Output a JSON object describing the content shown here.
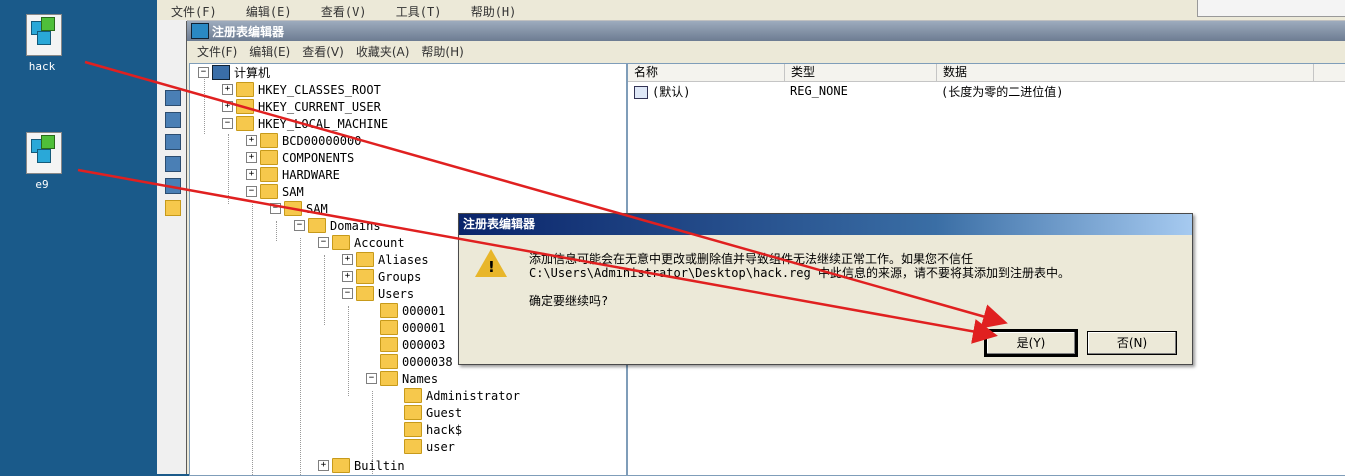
{
  "desktop": {
    "icons": [
      {
        "label": "hack",
        "icon": "reg-file-icon"
      },
      {
        "label": "e9",
        "icon": "reg-file-icon"
      }
    ]
  },
  "background_window": {
    "menu": [
      "文件(F)",
      "编辑(E)",
      "查看(V)",
      "工具(T)",
      "帮助(H)"
    ]
  },
  "regedit": {
    "title": "注册表编辑器",
    "menu": [
      "文件(F)",
      "编辑(E)",
      "查看(V)",
      "收藏夹(A)",
      "帮助(H)"
    ],
    "tree": {
      "root": "计算机",
      "hkcr": "HKEY_CLASSES_ROOT",
      "hkcu": "HKEY_CURRENT_USER",
      "hklm": "HKEY_LOCAL_MACHINE",
      "bcd": "BCD00000000",
      "components": "COMPONENTS",
      "hardware": "HARDWARE",
      "sam": "SAM",
      "sam_sam": "SAM",
      "domains": "Domains",
      "account": "Account",
      "aliases": "Aliases",
      "groups": "Groups",
      "users": "Users",
      "user_keys": [
        "000001",
        "000001",
        "000003",
        "0000038"
      ],
      "names": "Names",
      "name_keys": [
        "Administrator",
        "Guest",
        "hack$",
        "user"
      ],
      "builtin": "Builtin"
    },
    "list": {
      "headers": {
        "name": "名称",
        "type": "类型",
        "data": "数据"
      },
      "rows": [
        {
          "name": "(默认)",
          "type": "REG_NONE",
          "data": "(长度为零的二进位值)"
        }
      ]
    }
  },
  "dialog": {
    "title": "注册表编辑器",
    "message_line1": "添加信息可能会在无意中更改或删除值并导致组件无法继续正常工作。如果您不信任",
    "message_line2": "C:\\Users\\Administrator\\Desktop\\hack.reg 中此信息的来源，请不要将其添加到注册表中。",
    "question": "确定要继续吗?",
    "yes_label": "是(Y)",
    "no_label": "否(N)"
  },
  "colors": {
    "desktop": "#1a5a8a",
    "annotation_arrow": "#e02020",
    "dialog_title": "#0a246a"
  }
}
